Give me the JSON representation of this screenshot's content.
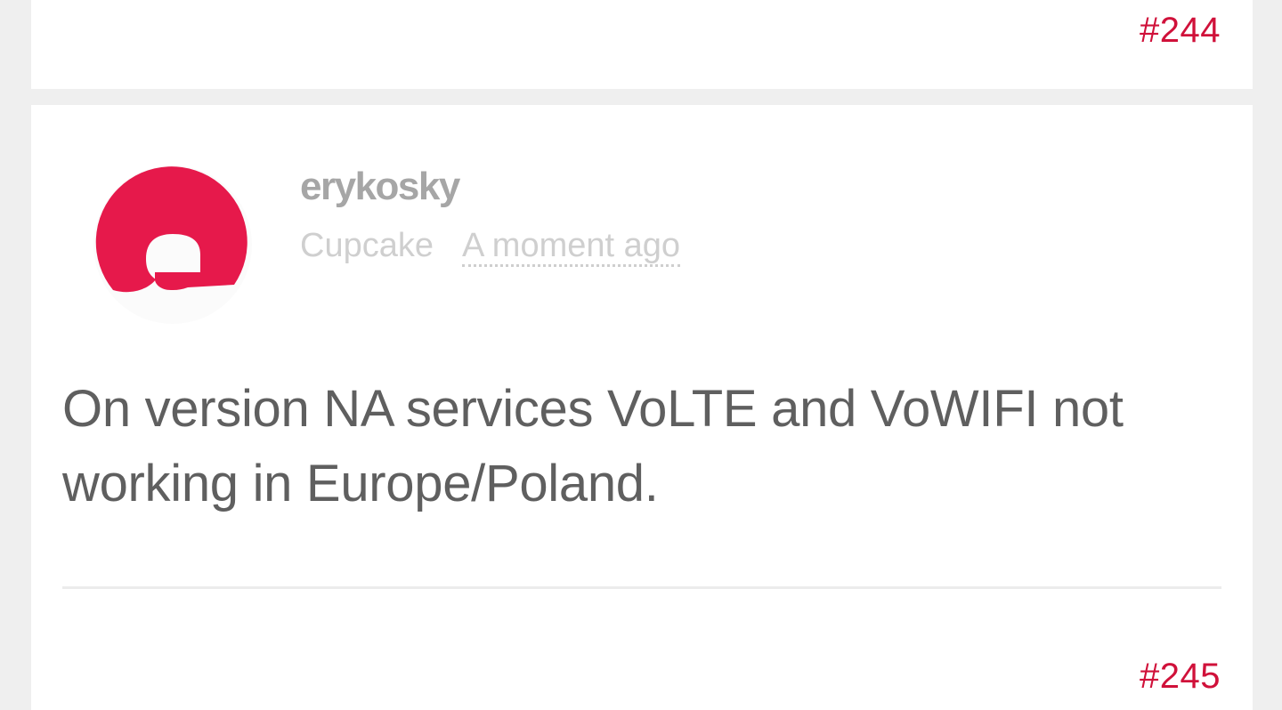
{
  "previous_post": {
    "number": "#244"
  },
  "post": {
    "author": {
      "username": "erykosky",
      "rank": "Cupcake",
      "avatar_icon": "e-letter-avatar-icon",
      "avatar_color": "#e6194b"
    },
    "timestamp": "A moment ago",
    "body": "On version NA services VoLTE and VoWIFI not working in Europe/Poland.",
    "number": "#245"
  },
  "colors": {
    "accent": "#d0113a",
    "background": "#efefef",
    "card": "#ffffff",
    "text": "#5f5f5f",
    "muted": "#a6a6a6"
  }
}
